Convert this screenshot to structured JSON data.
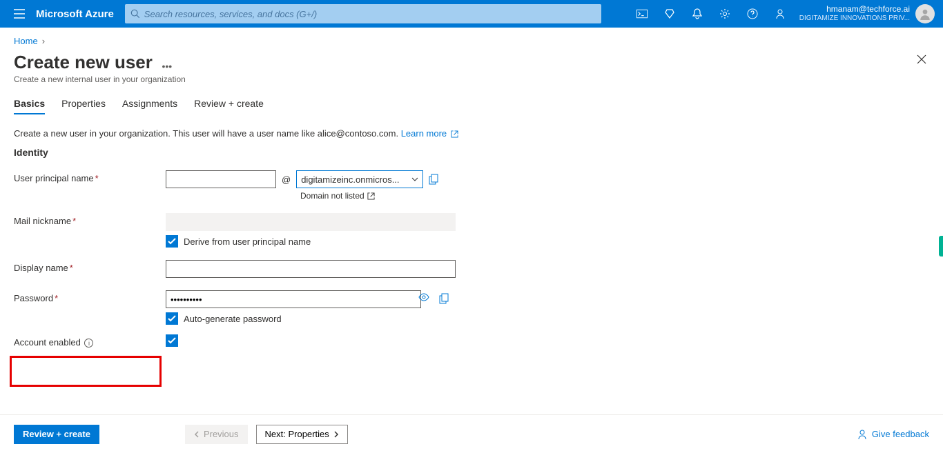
{
  "header": {
    "brand": "Microsoft Azure",
    "search_placeholder": "Search resources, services, and docs (G+/)",
    "account_email": "hmanam@techforce.ai",
    "account_org": "DIGITAMIZE INNOVATIONS PRIV..."
  },
  "breadcrumb": {
    "home": "Home"
  },
  "page": {
    "title": "Create new user",
    "subtitle": "Create a new internal user in your organization"
  },
  "tabs": [
    "Basics",
    "Properties",
    "Assignments",
    "Review + create"
  ],
  "description": {
    "text": "Create a new user in your organization. This user will have a user name like alice@contoso.com.",
    "learn_more": "Learn more"
  },
  "section_identity": "Identity",
  "form": {
    "upn": {
      "label": "User principal name",
      "value": "",
      "at": "@",
      "domain_selected": "digitamizeinc.onmicros...",
      "domain_not_listed": "Domain not listed"
    },
    "mail_nickname": {
      "label": "Mail nickname",
      "value": "",
      "derive_checked": true,
      "derive_label": "Derive from user principal name"
    },
    "display_name": {
      "label": "Display name",
      "value": ""
    },
    "password": {
      "label": "Password",
      "value": "••••••••••",
      "auto_checked": true,
      "auto_label": "Auto-generate password"
    },
    "account_enabled": {
      "label": "Account enabled",
      "checked": true
    }
  },
  "footer": {
    "review": "Review + create",
    "previous": "Previous",
    "next": "Next: Properties",
    "feedback": "Give feedback"
  }
}
